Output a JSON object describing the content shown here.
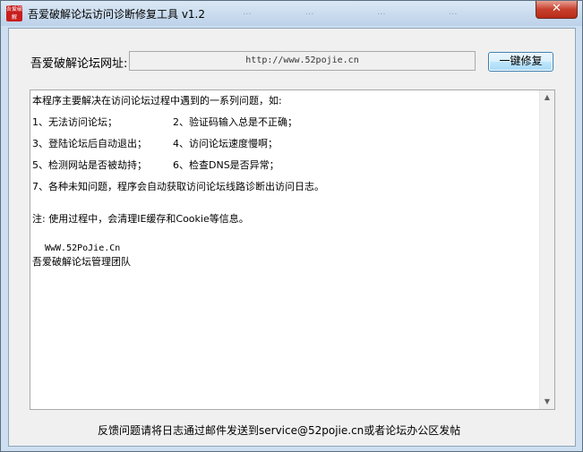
{
  "window": {
    "title": "吾爱破解论坛访问诊断修复工具 v1.2",
    "icon_text": "吾爱破解",
    "background_tabs": [
      "...",
      "...",
      "...",
      "..."
    ],
    "close_label": "✕"
  },
  "form": {
    "url_label": "吾爱破解论坛网址:",
    "url_value": "http://www.52pojie.cn",
    "repair_button": "一键修复"
  },
  "info": {
    "intro": "本程序主要解决在访问论坛过程中遇到的一系列问题，如:",
    "items": [
      {
        "left": "1、无法访问论坛；",
        "right": "2、验证码输入总是不正确；"
      },
      {
        "left": "3、登陆论坛后自动退出；",
        "right": "4、访问论坛速度慢啊；"
      },
      {
        "left": "5、检测网站是否被劫持；",
        "right": "6、检查DNS是否异常；"
      }
    ],
    "item7": "7、各种未知问题，程序会自动获取访问论坛线路诊断出访问日志。",
    "note": "注: 使用过程中，会清理IE缓存和Cookie等信息。",
    "domain": "WwW.52PoJie.Cn",
    "team": "吾爱破解论坛管理团队"
  },
  "footer": {
    "text": "反馈问题请将日志通过邮件发送到service@52pojie.cn或者论坛办公区发帖"
  },
  "colors": {
    "accent": "#3c7fb1",
    "close": "#c7402d"
  }
}
